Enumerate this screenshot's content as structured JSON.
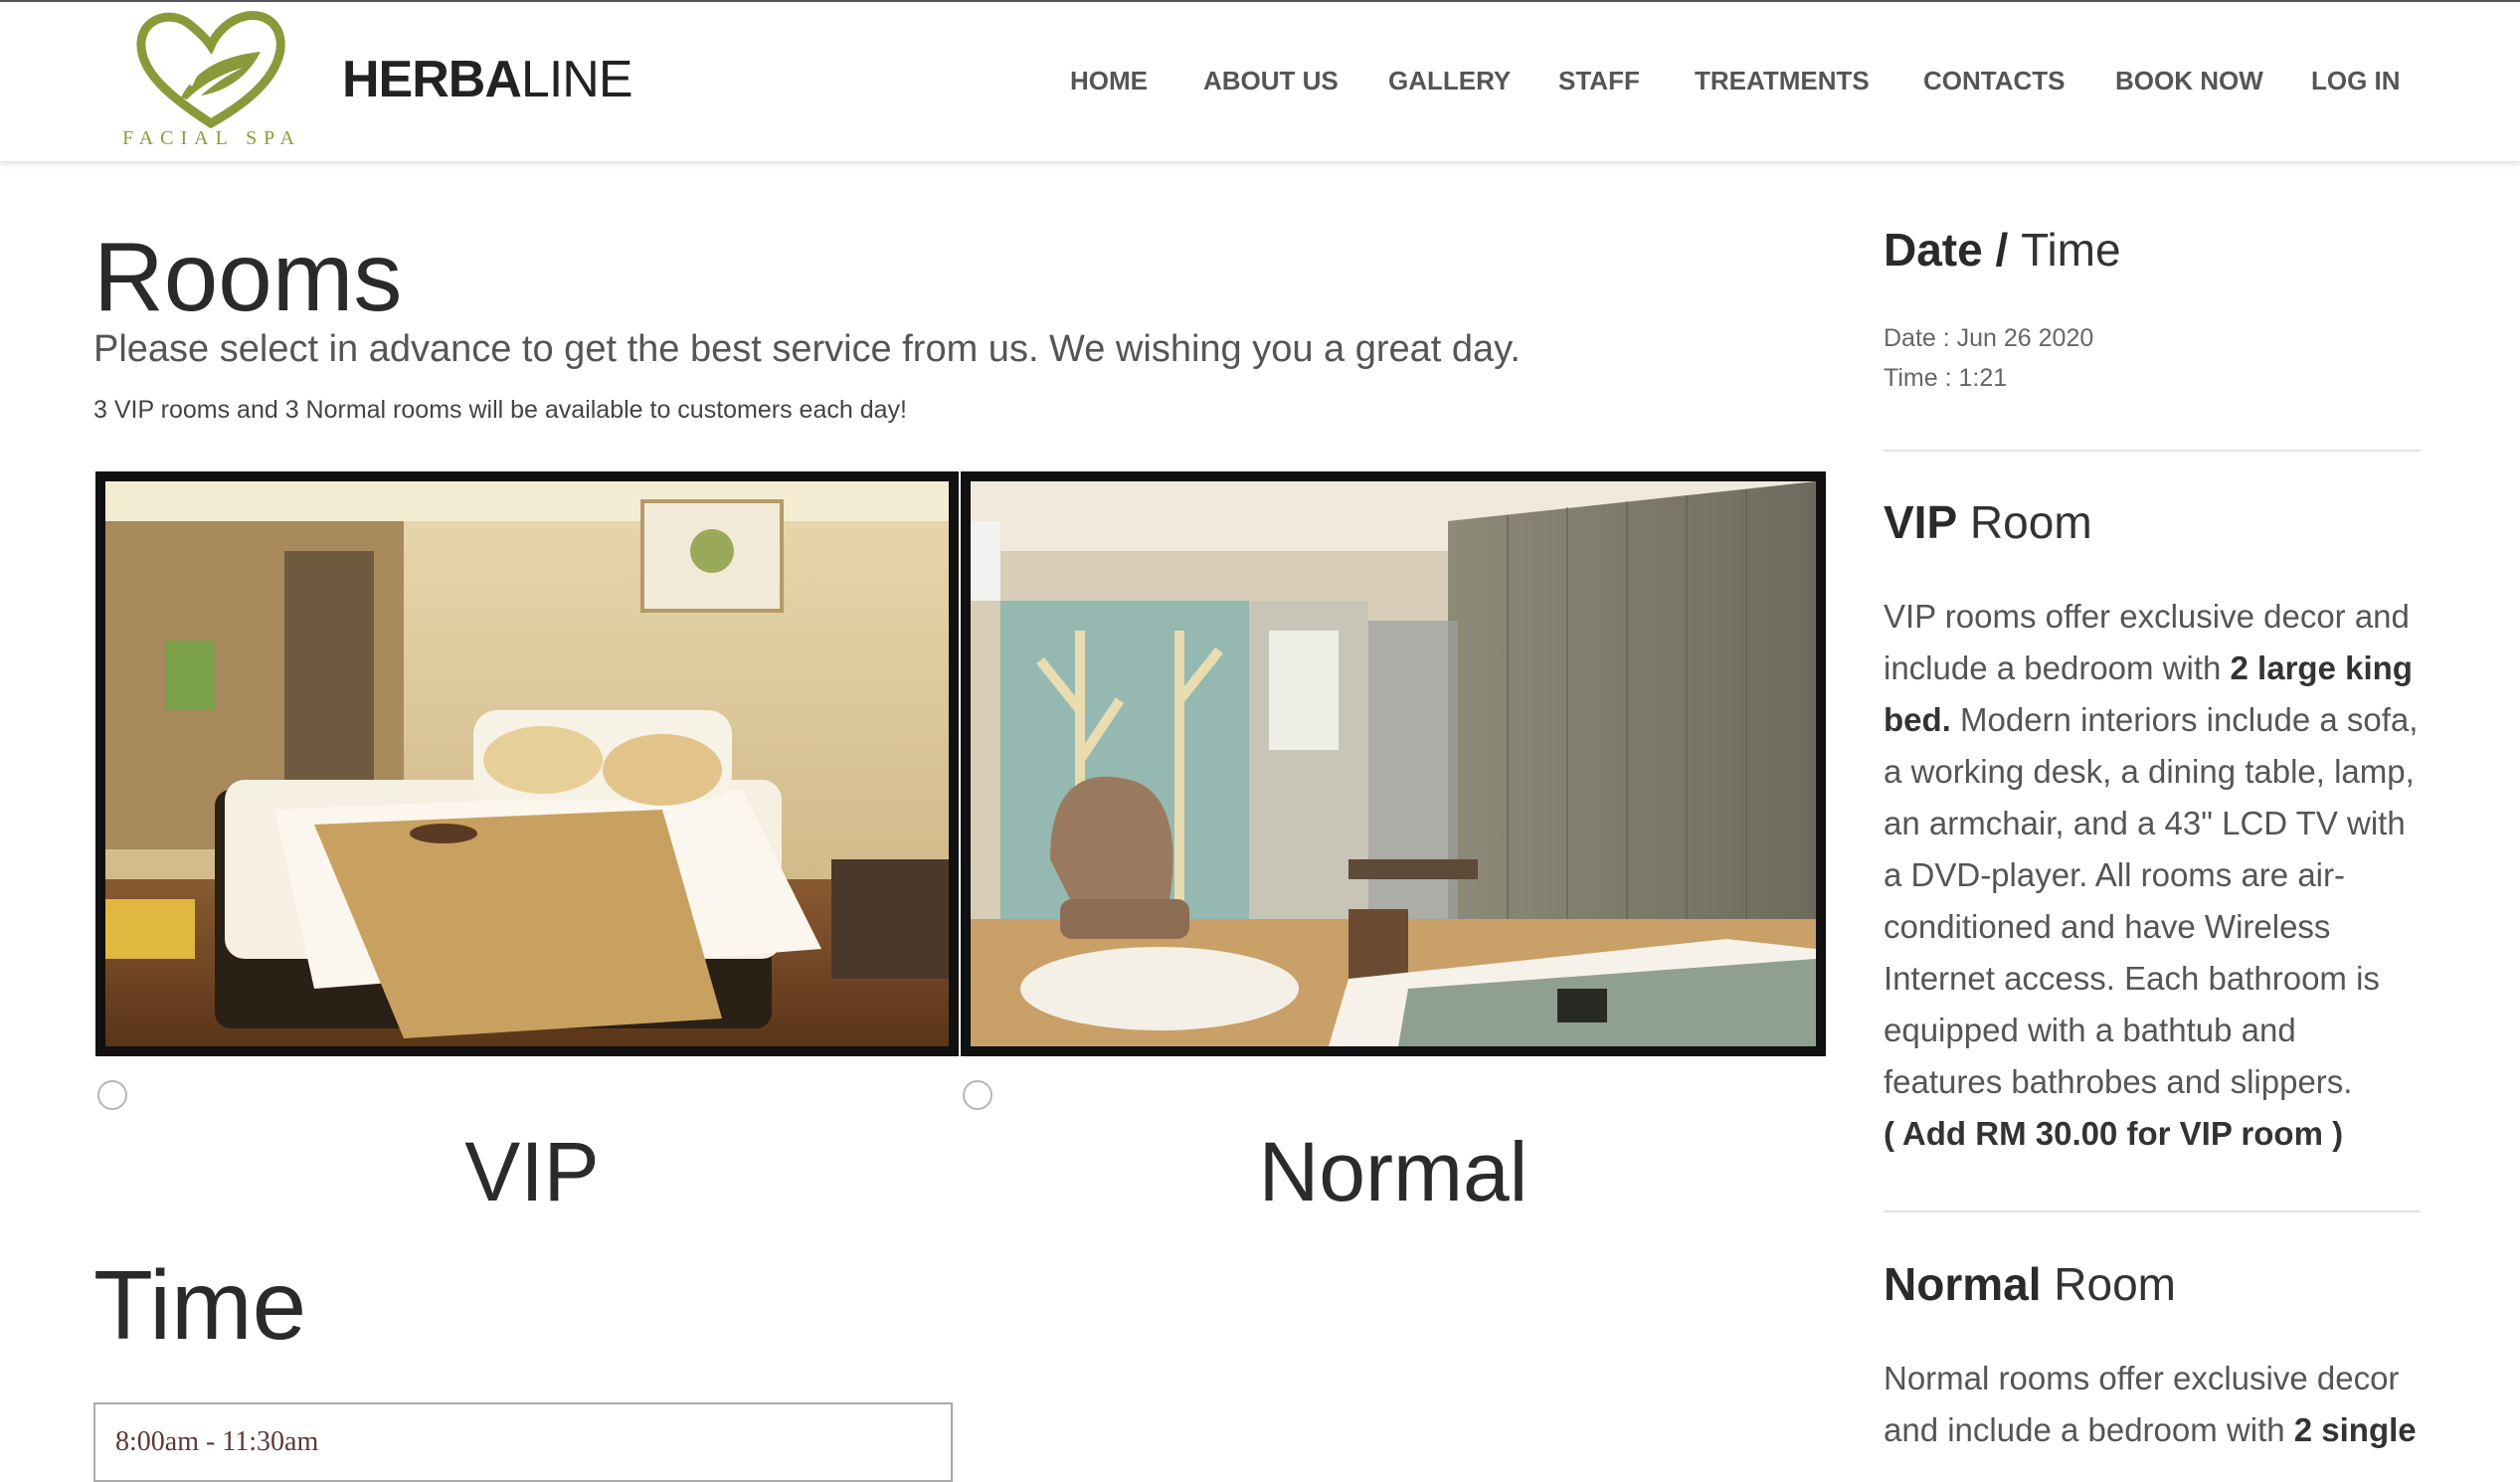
{
  "brand": {
    "logo_caption": "FACIAL SPA",
    "name_bold": "HERBA",
    "name_light": "LINE",
    "accent_color": "#8a9a3a"
  },
  "nav": {
    "items": [
      "HOME",
      "ABOUT US",
      "GALLERY",
      "STAFF",
      "TREATMENTS",
      "CONTACTS",
      "BOOK NOW",
      "LOG IN"
    ]
  },
  "rooms": {
    "title": "Rooms",
    "subtitle": "Please select in advance to get the best service from us. We wishing you a great day.",
    "note": "3 VIP rooms and 3 Normal rooms will be available to customers each day!",
    "options": [
      {
        "label": "VIP",
        "selected": false,
        "image_icon": "vip-room-photo"
      },
      {
        "label": "Normal",
        "selected": false,
        "image_icon": "normal-room-photo"
      }
    ]
  },
  "time": {
    "title": "Time",
    "selected": "8:00am - 11:30am"
  },
  "sidebar": {
    "datetime": {
      "heading_bold": "Date",
      "heading_sep": " / ",
      "heading_light": "Time",
      "date": "Date : Jun 26 2020",
      "time": "Time : 1:21"
    },
    "vip": {
      "heading_bold": "VIP",
      "heading_light": " Room",
      "text_1": "VIP rooms offer exclusive decor and include a bedroom with ",
      "text_bold_1": "2 large king bed.",
      "text_2": " Modern interiors include a sofa, a working desk, a dining table, lamp, an armchair, and a 43\" LCD TV with a DVD-player. All rooms are air-conditioned and have Wireless Internet access. Each bathroom is equipped with a bathtub and features bathrobes and slippers.",
      "price_note": "( Add RM 30.00 for VIP room )"
    },
    "normal": {
      "heading_bold": "Normal",
      "heading_light": " Room",
      "text_1": "Normal rooms offer exclusive decor and include a bedroom with ",
      "text_bold_1": "2 single"
    }
  }
}
